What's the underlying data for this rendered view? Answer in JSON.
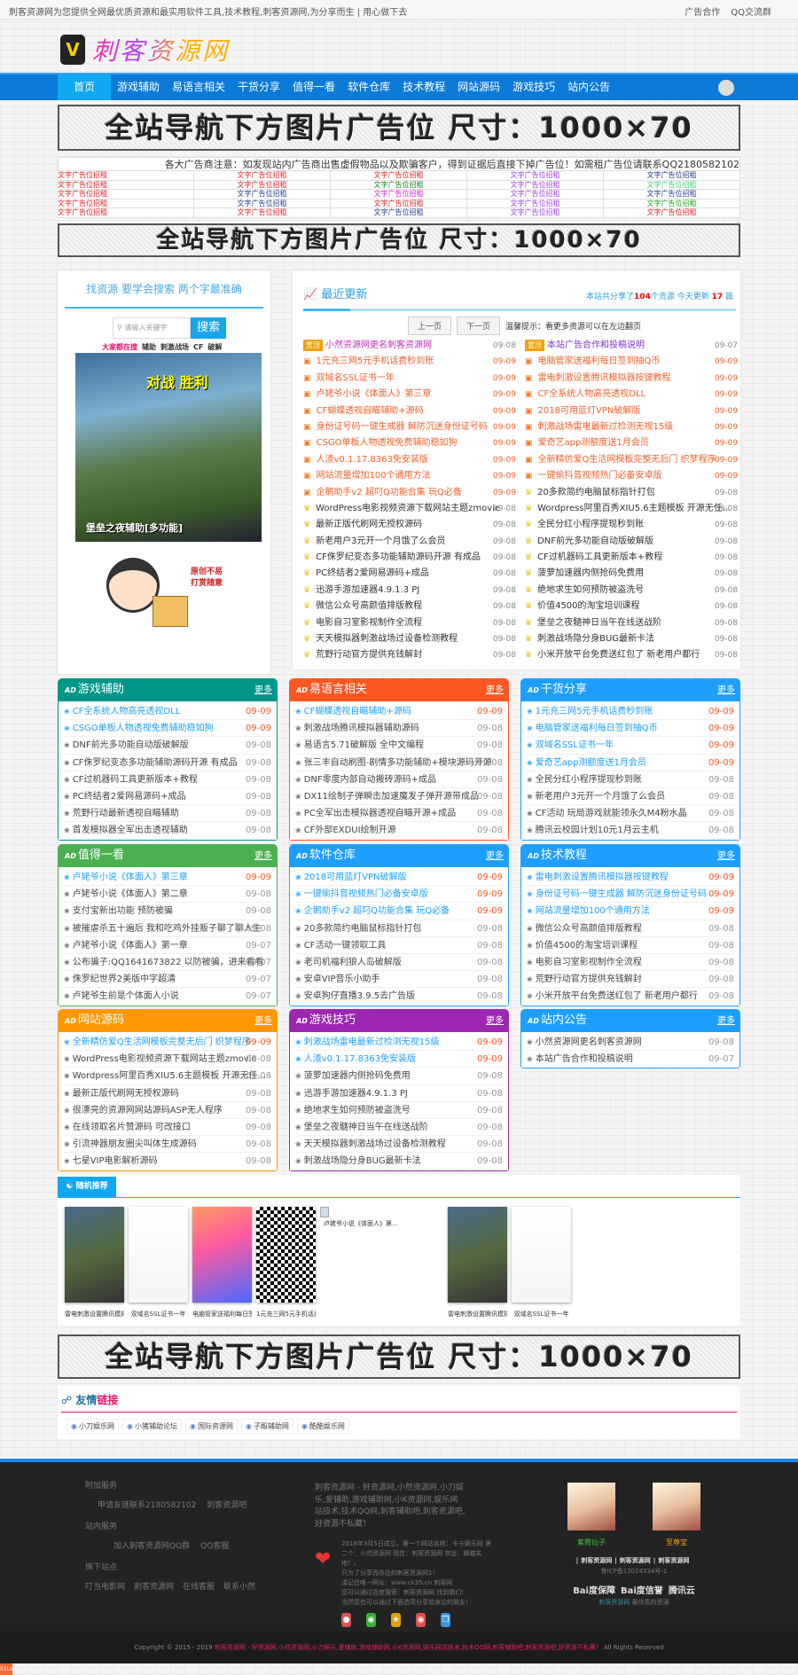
{
  "topbar": {
    "slogan": "刺客资源网为您提供全网最优质资源和最实用软件工具,技术教程,刺客资源网,为分享而生 | 用心做下去",
    "links": [
      "广告合作",
      "QQ交流群"
    ]
  },
  "logo": {
    "icon": "V",
    "text": "刺客资源网"
  },
  "nav": {
    "items": [
      "首页",
      "游戏辅助",
      "易语言相关",
      "干货分享",
      "值得一看",
      "软件仓库",
      "技术教程",
      "网站源码",
      "游戏技巧",
      "站内公告"
    ]
  },
  "banner": {
    "text": "全站导航下方图片广告位  尺寸：1000×70"
  },
  "notice": "各大广告商注意：如发现站内广告商出售虚假物品以及欺骗客户，得到证据后直接下掉广告位！如需租广告位请联系QQ2180582102",
  "ad_label": "文字广告位招租",
  "ad_colors": [
    [
      "#e02020",
      "#e02020",
      "#e02020",
      "#a040e0",
      "#203a90"
    ],
    [
      "#e02020",
      "#e02020",
      "#108010",
      "#a040e0",
      "#40d070"
    ],
    [
      "#e02020",
      "#203a90",
      "#e020e0",
      "#a040e0",
      "#203a90"
    ],
    [
      "#e02020",
      "#203a90",
      "#e02020",
      "#a040e0",
      "#20a020"
    ],
    [
      "#e02020",
      "#e02020",
      "#203a90",
      "#a040e0",
      "#e02020"
    ]
  ],
  "search": {
    "heading": "找资源 要学会搜索 两个字最准确",
    "placeholder": "请输入关键字",
    "button": "搜索",
    "hot_label": "大家都在搜",
    "hot": [
      "辅助",
      "刺激战场",
      "CF",
      "破解"
    ],
    "image_text": "对战 胜利",
    "image_caption": "堡垒之夜辅助[多功能]",
    "cartoon_text": "原创不易 打赏随意"
  },
  "recent": {
    "title": "最近更新",
    "stat_pre": "本站共分享了",
    "count": "104",
    "stat_mid": "个资源 今天更新",
    "today": "17",
    "stat_post": "篇",
    "prev": "上一页",
    "next": "下一页",
    "tip": "温馨提示：看更多资源可以在左边翻页",
    "top_label": "置顶",
    "left": [
      {
        "t": "小然资源网更名刺客资源网",
        "d": "09-08",
        "k": "top"
      },
      {
        "t": "1元充三网5元手机话费秒到账",
        "d": "09-09",
        "k": "hot"
      },
      {
        "t": "双域名SSL证书一年",
        "d": "09-09",
        "k": "hot"
      },
      {
        "t": "卢姥爷小说《体面人》第三章",
        "d": "09-09",
        "k": "hot"
      },
      {
        "t": "CF蝴蝶透视自瞄辅助+源码",
        "d": "09-09",
        "k": "hot"
      },
      {
        "t": "身份证号码一键生成器 解防沉迷身份证号码",
        "d": "09-09",
        "k": "hot"
      },
      {
        "t": "CSGO单板人物透视免费辅助稳如狗",
        "d": "09-09",
        "k": "hot"
      },
      {
        "t": "人渣v0.1.17.8363免安装版",
        "d": "09-09",
        "k": "hot"
      },
      {
        "t": "网站流量增加100个通用方法",
        "d": "09-09",
        "k": "hot"
      },
      {
        "t": "企鹅助手v2 超叼Q功能合集 玩Q必备",
        "d": "09-09",
        "k": "hot"
      },
      {
        "t": "WordPress电影视频资源下载网站主题zmovie",
        "d": "09-08",
        "k": "n"
      },
      {
        "t": "最新正版代刷网无授权源码",
        "d": "09-08",
        "k": "n"
      },
      {
        "t": "新老用户3元开一个月饿了么会员",
        "d": "09-08",
        "k": "n"
      },
      {
        "t": "CF侏罗纪变态多功能辅助源码开源 有成品",
        "d": "09-08",
        "k": "n"
      },
      {
        "t": "PC终结者2爱网易源码+成品",
        "d": "09-08",
        "k": "n"
      },
      {
        "t": "迅游手游加速器4.9.1.3 PJ",
        "d": "09-08",
        "k": "n"
      },
      {
        "t": "微信公众号高颜值排版教程",
        "d": "09-08",
        "k": "n"
      },
      {
        "t": "电影自习室影视制作全流程",
        "d": "09-08",
        "k": "n"
      },
      {
        "t": "天天模拟器刺激战场过设备检测教程",
        "d": "09-08",
        "k": "n"
      },
      {
        "t": "荒野行动官方提供充钱解封",
        "d": "09-08",
        "k": "n"
      }
    ],
    "right": [
      {
        "t": "本站广告合作和投稿说明",
        "d": "09-07",
        "k": "top"
      },
      {
        "t": "电脑管家送福利每日签到抽Q币",
        "d": "09-09",
        "k": "hot"
      },
      {
        "t": "雷电刺激设置腾讯模拟器按键教程",
        "d": "09-09",
        "k": "hot"
      },
      {
        "t": "CF全系统人物高亮透视DLL",
        "d": "09-09",
        "k": "hot"
      },
      {
        "t": "2018可用蓝灯VPN破解版",
        "d": "09-09",
        "k": "hot"
      },
      {
        "t": "刺激战场雷电最新过检测无视15级",
        "d": "09-09",
        "k": "hot"
      },
      {
        "t": "爱奇艺app测额度送1月会员",
        "d": "09-09",
        "k": "hot"
      },
      {
        "t": "全新精仿爱Q生活网模板完整无后门 织梦程序",
        "d": "09-09",
        "k": "hot"
      },
      {
        "t": "一键偷抖音视频热门必备安卓版",
        "d": "09-09",
        "k": "hot"
      },
      {
        "t": "20多款简约电脑鼠标指针打包",
        "d": "09-08",
        "k": "n"
      },
      {
        "t": "Wordpress阿里百秀XIU5.6主题模板 开源无任...",
        "d": "09-08",
        "k": "n"
      },
      {
        "t": "全民分红小程序提现秒到账",
        "d": "09-08",
        "k": "n"
      },
      {
        "t": "DNF前光多功能自动版破解版",
        "d": "09-08",
        "k": "n"
      },
      {
        "t": "CF过机器码工具更新版本+教程",
        "d": "09-08",
        "k": "n"
      },
      {
        "t": "菠萝加速器内侧抢码免费用",
        "d": "09-08",
        "k": "n"
      },
      {
        "t": "绝地求生如何预防被盗洗号",
        "d": "09-08",
        "k": "n"
      },
      {
        "t": "价值4500的淘宝培训课程",
        "d": "09-08",
        "k": "n"
      },
      {
        "t": "堡垒之夜髓神日当午在线送战阶",
        "d": "09-08",
        "k": "n"
      },
      {
        "t": "刺激战场隐分身BUG最新卡法",
        "d": "09-08",
        "k": "n"
      },
      {
        "t": "小米开放平台免费送红包了 新老用户都行",
        "d": "09-08",
        "k": "n"
      }
    ]
  },
  "box_ad": "AD",
  "more": "更多",
  "boxes": [
    {
      "title": "游戏辅助",
      "color": "#009688",
      "hot": 2,
      "items": [
        [
          "CF全系统人物高亮透视DLL",
          "09-09"
        ],
        [
          "CSGO单板人物透视免费辅助稳如狗",
          "09-09"
        ],
        [
          "DNF前光多功能自动版破解版",
          "09-08"
        ],
        [
          "CF侏罗纪变态多功能辅助源码开源 有成品",
          "09-08"
        ],
        [
          "CF过机器码工具更新版本+教程",
          "09-08"
        ],
        [
          "PC终结者2爱网易源码+成品",
          "09-08"
        ],
        [
          "荒野行动最新透视自瞄辅助",
          "09-08"
        ],
        [
          "首发模拟器全军出击透视辅助",
          "09-08"
        ]
      ]
    },
    {
      "title": "易语言相关",
      "color": "#ff5722",
      "hot": 1,
      "items": [
        [
          "CF蝴蝶透视自瞄辅助+源码",
          "09-09"
        ],
        [
          "刺激战场腾讯模拟器辅助源码",
          "09-08"
        ],
        [
          "易语言5.71破解版 全中文编程",
          "09-08"
        ],
        [
          "张三丰自动刷图-剧情多功能辅助+模块源码开源",
          "09-08"
        ],
        [
          "DNF零度内部自动搬砖源码+成品",
          "09-08"
        ],
        [
          "DX11绘制子弹瞬击加速魔发子弹开源带成品",
          "09-08"
        ],
        [
          "PC全军出击模拟器透视自瞄开源+成品",
          "09-08"
        ],
        [
          "CF外部EXDUI绘制开源",
          "09-08"
        ]
      ]
    },
    {
      "title": "干货分享",
      "color": "#1e9fff",
      "hot": 4,
      "items": [
        [
          "1元充三网5元手机话费秒到账",
          "09-09"
        ],
        [
          "电脑管家送福利每日签到抽Q币",
          "09-09"
        ],
        [
          "双域名SSL证书一年",
          "09-09"
        ],
        [
          "爱奇艺app测额度送1月会员",
          "09-09"
        ],
        [
          "全民分红小程序提现秒到账",
          "09-08"
        ],
        [
          "新老用户3元开一个月饿了么会员",
          "09-08"
        ],
        [
          "CF活动 玩局游戏就能领永久M4粉水晶",
          "09-08"
        ],
        [
          "腾讯云校园计划10元1月云主机",
          "09-08"
        ]
      ]
    },
    {
      "title": "值得一看",
      "color": "#4caf50",
      "hot": 1,
      "items": [
        [
          "卢姥爷小说《体面人》第三章",
          "09-09"
        ],
        [
          "卢姥爷小说《体面人》第二章",
          "09-08"
        ],
        [
          "支付宝新出功能 预防被骗",
          "09-08"
        ],
        [
          "被摧虐杀五十遍后 我和吃鸡外挂贩子聊了聊人生",
          "09-08"
        ],
        [
          "卢姥爷小说《体面人》第一章",
          "09-07"
        ],
        [
          "公布骗子:QQ1641673822 以防被骗，进来看看",
          "09-07"
        ],
        [
          "侏罗纪世界2美版中字超清",
          "09-07"
        ],
        [
          "卢姥爷生前是个体面人小说",
          "09-07"
        ]
      ]
    },
    {
      "title": "软件仓库",
      "color": "#1e9fff",
      "hot": 3,
      "items": [
        [
          "2018可用蓝灯VPN破解版",
          "09-09"
        ],
        [
          "一键偷抖音视频热门必备安卓版",
          "09-09"
        ],
        [
          "企鹅助手v2 超叼Q功能合集 玩Q必备",
          "09-09"
        ],
        [
          "20多款简约电脑鼠标指针打包",
          "09-08"
        ],
        [
          "CF活动一键领取工具",
          "09-08"
        ],
        [
          "老司机福利狼人岛破解版",
          "09-08"
        ],
        [
          "安卓VIP音乐小助手",
          "09-08"
        ],
        [
          "安卓狗仔直播3.9.5去广告版",
          "09-08"
        ]
      ]
    },
    {
      "title": "技术教程",
      "color": "#1e9fff",
      "hot": 3,
      "items": [
        [
          "雷电刺激设置腾讯模拟器按键教程",
          "09-09"
        ],
        [
          "身份证号码一键生成器 解防沉迷身份证号码",
          "09-09"
        ],
        [
          "网站流量增加100个通用方法",
          "09-09"
        ],
        [
          "微信公众号高颜值排版教程",
          "09-08"
        ],
        [
          "价值4500的淘宝培训课程",
          "09-08"
        ],
        [
          "电影自习室影视制作全流程",
          "09-08"
        ],
        [
          "荒野行动官方提供充钱解封",
          "09-08"
        ],
        [
          "小米开放平台免费送红包了 新老用户都行",
          "09-08"
        ]
      ]
    },
    {
      "title": "网站源码",
      "color": "#ff9800",
      "hot": 1,
      "items": [
        [
          "全新精仿爱Q生活网模板完整无后门 织梦程序",
          "09-09"
        ],
        [
          "WordPress电影视频资源下载网站主题zmovie",
          "09-08"
        ],
        [
          "Wordpress阿里百秀XIU5.6主题模板 开源无任...",
          "09-08"
        ],
        [
          "最新正版代刷网无授权源码",
          "09-08"
        ],
        [
          "很漂亮的资源网网站源码ASP无人程序",
          "09-08"
        ],
        [
          "在线领取名片赞源码 可改接口",
          "09-08"
        ],
        [
          "引流神器朋友圈尖叫体生成源码",
          "09-08"
        ],
        [
          "七星VIP电影解析源码",
          "09-08"
        ]
      ]
    },
    {
      "title": "游戏技巧",
      "color": "#9c27b0",
      "hot": 2,
      "items": [
        [
          "刺激战场雷电最新过检测无视15级",
          "09-09"
        ],
        [
          "人渣v0.1.17.8363免安装版",
          "09-09"
        ],
        [
          "菠萝加速器内侧抢码免费用",
          "09-08"
        ],
        [
          "迅游手游加速器4.9.1.3 PJ",
          "09-08"
        ],
        [
          "绝地求生如何预防被盗洗号",
          "09-08"
        ],
        [
          "堡垒之夜髓神日当午在线送战阶",
          "09-08"
        ],
        [
          "天天模拟器刺激战场过设备检测教程",
          "09-08"
        ],
        [
          "刺激战场隐分身BUG最新卡法",
          "09-08"
        ]
      ]
    },
    {
      "title": "站内公告",
      "color": "#1e9fff",
      "hot": 0,
      "items": [
        [
          "小然资源网更名刺客资源网",
          "09-08"
        ],
        [
          "本站广告合作和投稿说明",
          "09-07"
        ]
      ]
    }
  ],
  "random": {
    "tab": "随机推荐",
    "items": [
      "雷电刺激设置腾讯模拟器...",
      "双域名SSL证书一年",
      "电脑管家送福利每日签到...",
      "1元充三网5元手机话费秒...",
      "卢姥爷小说《体面人》第...",
      "雷电刺激设置腾讯模拟器...",
      "双域名SSL证书一年"
    ]
  },
  "links": {
    "title_a": "友情",
    "title_b": "链接",
    "items": [
      "小刀娱乐网",
      "小猪辅助论坛",
      "国际资源网",
      "子殿辅助网",
      "酷酷娱乐网"
    ]
  },
  "footer": {
    "g1": "附加服务",
    "g1_items": [
      "申请友链联系2180582102",
      "刺客资源吧"
    ],
    "g2": "站内服务",
    "g2_items": [
      "加入刺客资源网QQ群",
      "QQ客服"
    ],
    "g3": "旗下站点",
    "g3_items": [
      "叮当电影网",
      "刺客资源网",
      "在线客服",
      "联系小然"
    ],
    "about": "刺客资源网 - 好资源网,小然资源网,小刀娱乐,爱辅助,游戏辅助网,小K资源网,娱乐网站技术,技术QQ网,刺客辅助吧,刺客资源吧,好资源不私藏！",
    "msg": [
      "2018年3月5日成立。第一个网站名称：卡卡娱乐网 第二个：小然资源网 现在：刺客资源网 宗旨：脚踏实地！。",
      "只为了分享而存在的刺客资源网1！",
      "请记住唯一网址：www.ck35.cn 刺客网",
      "您可以通过百度搜索：刺客资源网 找到我们!",
      "当然您也可以通过下面选项分享给身边的朋友！"
    ],
    "avatars": [
      {
        "name": "紫霞仙子",
        "color": "#40c040"
      },
      {
        "name": "至尊宝",
        "color": "#f0a000"
      }
    ],
    "site_links": [
      "刺客资源网",
      "刺客资源网",
      "刺客资源网"
    ],
    "icp": "鲁ICP备13024334号-1",
    "badges": [
      "Bai度保障",
      "Bai度信誉",
      "腾讯云"
    ],
    "slogan_a": "刺客资源网",
    "slogan_b": " 最优质的资源"
  },
  "copyright": {
    "pre": "Copyright © 2015 - 2019 ",
    "mid": "刺客资源网 - 好资源网,小然资源网,小刀娱乐,爱辅助,游戏辅助网,小K资源网,娱乐网站技术,技术QQ网,刺客辅助吧,刺客资源吧,好资源不私藏！",
    "post": " All Rights Reserved"
  },
  "stat_badge": "51La"
}
